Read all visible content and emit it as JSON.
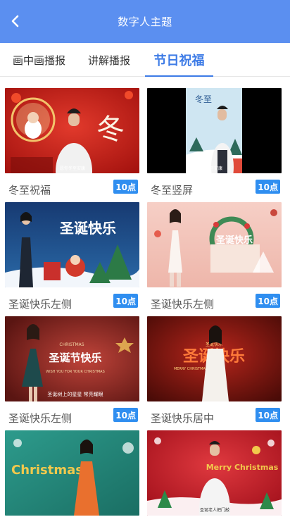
{
  "header": {
    "title": "数字人主题"
  },
  "tabs": [
    {
      "label": "画中画播报"
    },
    {
      "label": "讲解播报"
    },
    {
      "label": "节日祝福"
    }
  ],
  "cards": [
    {
      "title": "冬至祝福",
      "badge": "10点",
      "thumb_text": "冬",
      "subtitle": "愿你冬至安康"
    },
    {
      "title": "冬至竖屏",
      "badge": "10点",
      "thumb_text": "冬至",
      "subtitle": "冬至安康"
    },
    {
      "title": "圣诞快乐左侧",
      "badge": "10点",
      "thumb_text": "圣诞快乐"
    },
    {
      "title": "圣诞快乐左侧",
      "badge": "10点",
      "thumb_text": "圣诞快乐"
    },
    {
      "title": "圣诞快乐左侧",
      "badge": "10点",
      "thumb_text": "圣诞节快乐",
      "caption_top": "CHRISTMAS",
      "caption_mid": "WISH YOU FOR YOUR CHRISTMAS",
      "subtitle": "圣诞树上的星星 常亮耀眼"
    },
    {
      "title": "圣诞快乐居中",
      "badge": "10点",
      "thumb_text": "圣诞快乐",
      "caption_top": "圣诞快乐",
      "caption_mid": "MERRY CHRISTMAS"
    },
    {
      "title": "",
      "badge": "",
      "thumb_text": "Christmas"
    },
    {
      "title": "",
      "badge": "",
      "thumb_text": "Merry Christmas",
      "subtitle": "圣诞老人把门敲"
    }
  ]
}
